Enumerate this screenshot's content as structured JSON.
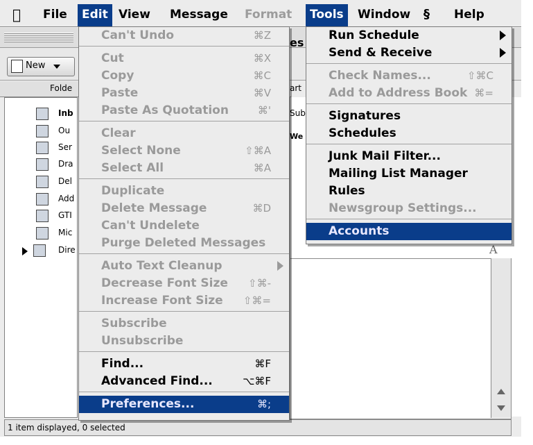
{
  "menubar": {
    "apple_icon": "apple-icon",
    "file": "File",
    "edit": "Edit",
    "view": "View",
    "message": "Message",
    "format": "Format",
    "tools": "Tools",
    "window": "Window",
    "script_icon": "script-icon",
    "help": "Help"
  },
  "toolbar": {
    "new_label": "New"
  },
  "columns": {
    "folders": "Folde"
  },
  "folders": [
    "Inb",
    "Ou",
    "Ser",
    "Dra",
    "Del",
    "Add",
    "GTI",
    "Mic",
    "Dire"
  ],
  "partial_texts": {
    "es": "es",
    "art": "art",
    "sub": "Sub",
    "web": "We"
  },
  "status": {
    "text": "1 item displayed, 0 selected"
  },
  "edit_menu": {
    "groups": [
      [
        {
          "label": "Can't Undo",
          "shortcut": "⌘Z",
          "enabled": false
        }
      ],
      [
        {
          "label": "Cut",
          "shortcut": "⌘X",
          "enabled": false
        },
        {
          "label": "Copy",
          "shortcut": "⌘C",
          "enabled": false
        },
        {
          "label": "Paste",
          "shortcut": "⌘V",
          "enabled": false
        },
        {
          "label": "Paste As Quotation",
          "shortcut": "⌘'",
          "enabled": false
        }
      ],
      [
        {
          "label": "Clear",
          "shortcut": "",
          "enabled": false
        },
        {
          "label": "Select None",
          "shortcut": "⇧⌘A",
          "enabled": false
        },
        {
          "label": "Select All",
          "shortcut": "⌘A",
          "enabled": false
        }
      ],
      [
        {
          "label": "Duplicate",
          "shortcut": "",
          "enabled": false
        },
        {
          "label": "Delete Message",
          "shortcut": "⌘D",
          "enabled": false
        },
        {
          "label": "Can't Undelete",
          "shortcut": "",
          "enabled": false
        },
        {
          "label": "Purge Deleted Messages",
          "shortcut": "",
          "enabled": false
        }
      ],
      [
        {
          "label": "Auto Text Cleanup",
          "shortcut": "",
          "enabled": false,
          "submenu": true
        },
        {
          "label": "Decrease Font Size",
          "shortcut": "⇧⌘-",
          "enabled": false
        },
        {
          "label": "Increase Font Size",
          "shortcut": "⇧⌘=",
          "enabled": false
        }
      ],
      [
        {
          "label": "Subscribe",
          "shortcut": "",
          "enabled": false
        },
        {
          "label": "Unsubscribe",
          "shortcut": "",
          "enabled": false
        }
      ],
      [
        {
          "label": "Find...",
          "shortcut": "⌘F",
          "enabled": true
        },
        {
          "label": "Advanced Find...",
          "shortcut": "⌥⌘F",
          "enabled": true
        }
      ],
      [
        {
          "label": "Preferences...",
          "shortcut": "⌘;",
          "enabled": true,
          "highlighted": true
        }
      ]
    ]
  },
  "tools_menu": {
    "groups": [
      [
        {
          "label": "Run Schedule",
          "shortcut": "",
          "enabled": true,
          "submenu": true
        },
        {
          "label": "Send & Receive",
          "shortcut": "",
          "enabled": true,
          "submenu": true
        }
      ],
      [
        {
          "label": "Check Names...",
          "shortcut": "⇧⌘C",
          "enabled": false
        },
        {
          "label": "Add to Address Book",
          "shortcut": "⌘=",
          "enabled": false
        }
      ],
      [
        {
          "label": "Signatures",
          "shortcut": "",
          "enabled": true
        },
        {
          "label": "Schedules",
          "shortcut": "",
          "enabled": true
        }
      ],
      [
        {
          "label": "Junk Mail Filter...",
          "shortcut": "",
          "enabled": true
        },
        {
          "label": "Mailing List Manager",
          "shortcut": "",
          "enabled": true
        },
        {
          "label": "Rules",
          "shortcut": "",
          "enabled": true
        },
        {
          "label": "Newsgroup Settings...",
          "shortcut": "",
          "enabled": false
        }
      ],
      [
        {
          "label": "Accounts",
          "shortcut": "",
          "enabled": true,
          "highlighted": true
        }
      ]
    ]
  },
  "colors": {
    "highlight": "#0a3d8a",
    "disabled": "#9a9a9a",
    "menu_bg": "#ececec"
  }
}
